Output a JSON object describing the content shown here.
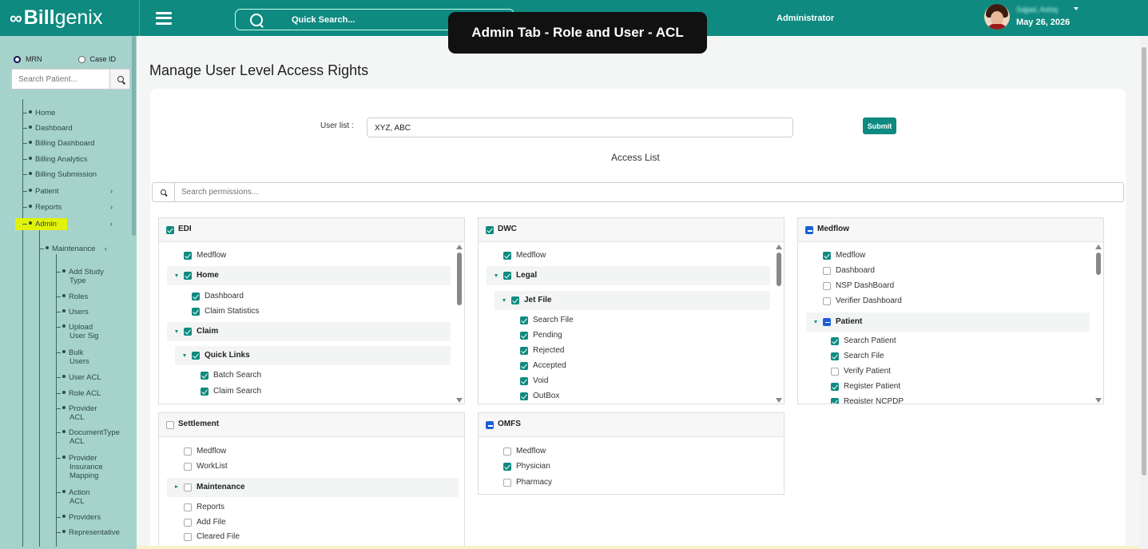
{
  "app": {
    "brand_part1": "Bill",
    "brand_part2": "genix",
    "logo_icon": "infinity-icon"
  },
  "topbar": {
    "quick_search": "Quick Search...",
    "role": "Administrator",
    "user_name": "Sajjad, Ashiq",
    "date": "May 26, 2026"
  },
  "banner": "Admin Tab - Role and User - ACL",
  "sidebar": {
    "radio_mrn": "MRN",
    "radio_caseid": "Case ID",
    "search_placeholder": "Search Patient...",
    "items": [
      "Home",
      "Dashboard",
      "Billing Dashboard",
      "Billing Analytics",
      "Billing Submission",
      "Patient",
      "Reports",
      "Admin"
    ],
    "maintenance": "Maintenance",
    "sub_items": [
      [
        "Add Study",
        "Type"
      ],
      [
        "Roles"
      ],
      [
        "Users"
      ],
      [
        "Upload",
        "User Sig"
      ],
      [
        "Bulk",
        "Users"
      ],
      [
        "User ACL"
      ],
      [
        "Role ACL"
      ],
      [
        "Provider",
        "ACL"
      ],
      [
        "DocumentType",
        "ACL"
      ],
      [
        "Provider",
        "Insurance",
        "Mapping"
      ],
      [
        "Action",
        "ACL"
      ],
      [
        "Providers"
      ],
      [
        "Representative"
      ]
    ]
  },
  "page": {
    "title": "Manage User Level Access Rights",
    "user_list_label": "User list :",
    "user_list_value": "XYZ, ABC",
    "submit": "Submit",
    "access_list": "Access List",
    "perm_search_placeholder": "Search permissions..."
  },
  "panels": {
    "edi": {
      "title": "EDI",
      "items": [
        "Medflow",
        "Home",
        "Dashboard",
        "Claim Statistics",
        "Claim",
        "Quick Links",
        "Batch Search",
        "Claim Search"
      ]
    },
    "dwc": {
      "title": "DWC",
      "items": [
        "Medflow",
        "Legal",
        "Jet File",
        "Search File",
        "Pending",
        "Rejected",
        "Accepted",
        "Void",
        "OutBox"
      ]
    },
    "medflow": {
      "title": "Medflow",
      "items": [
        "Medflow",
        "Dashboard",
        "NSP DashBoard",
        "Verifier Dashboard",
        "Patient",
        "Search Patient",
        "Search File",
        "Verify Patient",
        "Register Patient",
        "Register NCPDP"
      ]
    },
    "settlement": {
      "title": "Settlement",
      "items": [
        "Medflow",
        "WorkList",
        "Maintenance",
        "Reports",
        "Add File",
        "Cleared File"
      ]
    },
    "omfs": {
      "title": "OMFS",
      "items": [
        "Medflow",
        "Physician",
        "Pharmacy"
      ]
    }
  },
  "colors": {
    "brand": "#0f8a80",
    "sidebar": "#a6d2cc",
    "highlight": "#e2f20a",
    "indeterminate": "#1a5fd6"
  }
}
